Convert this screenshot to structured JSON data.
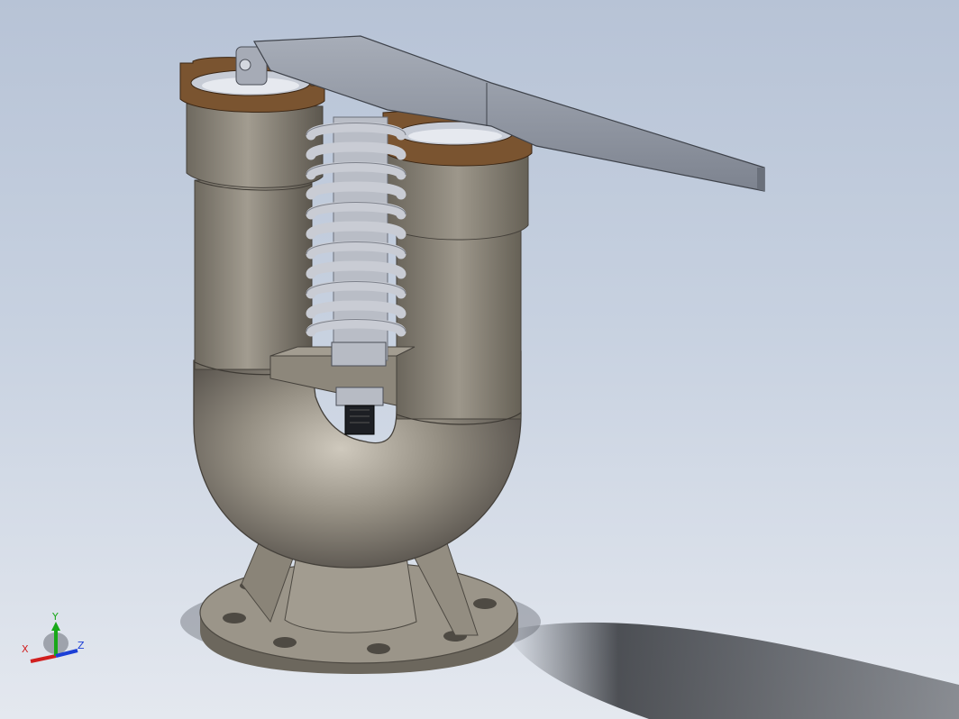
{
  "viewport": {
    "background_top": "#b7c3d6",
    "background_bottom": "#e4e8ef"
  },
  "model": {
    "body_color": "#8f897c",
    "seat_ring_color": "#7a5430",
    "lever_color": "#9096a2",
    "spring_color": "#c9ccd4"
  },
  "triad": {
    "x_label": "X",
    "y_label": "Y",
    "z_label": "Z",
    "x_color": "#d11f1f",
    "y_color": "#18a818",
    "z_color": "#1c3fd6"
  }
}
